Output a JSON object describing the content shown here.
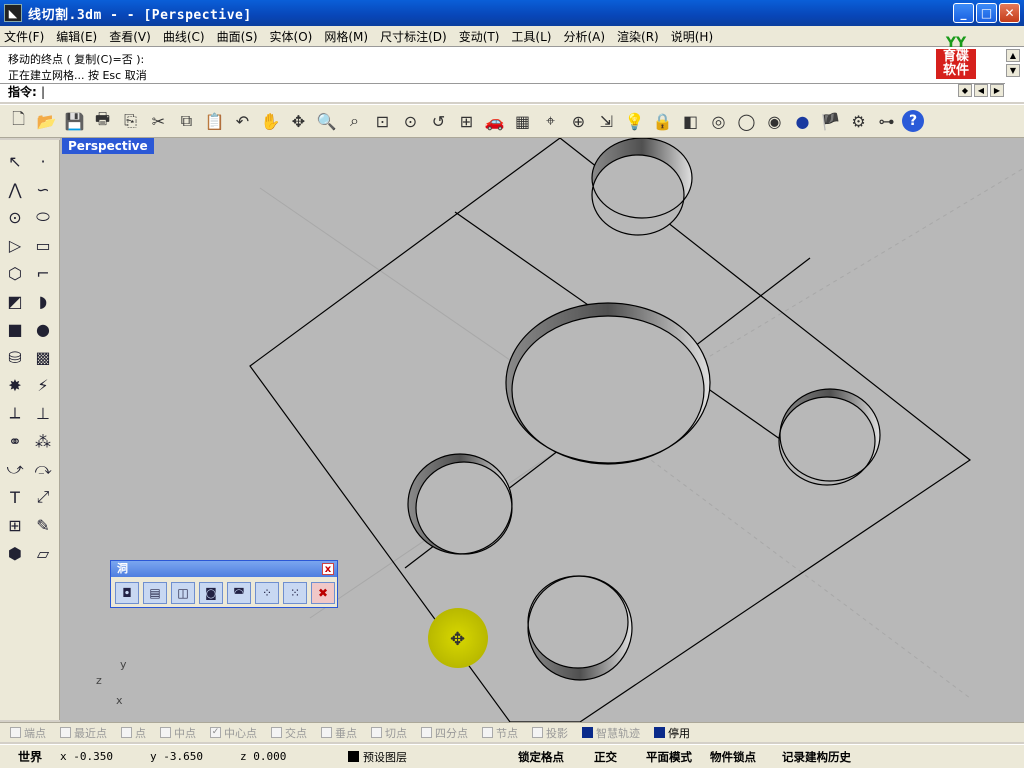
{
  "window": {
    "title": "线切割.3dm - - [Perspective]",
    "minimize": "_",
    "maximize": "□",
    "close": "✕"
  },
  "menu": [
    "文件(F)",
    "编辑(E)",
    "查看(V)",
    "曲线(C)",
    "曲面(S)",
    "实体(O)",
    "网格(M)",
    "尺寸标注(D)",
    "变动(T)",
    "工具(L)",
    "分析(A)",
    "渲染(R)",
    "说明(H)"
  ],
  "command": {
    "history": [
      "移动的终点 ( 复制(C)=否 ):",
      "正在建立网格... 按 Esc 取消"
    ],
    "prompt": "指令:",
    "logo_top": "YY",
    "logo_line1": "育碟",
    "logo_line2": "软件"
  },
  "toolbar_icons": [
    "new-file-icon",
    "open-folder-icon",
    "save-icon",
    "print-icon",
    "import-icon",
    "cut-icon",
    "copy-icon",
    "paste-icon",
    "undo-icon",
    "pan-hand-icon",
    "rotate-view-icon",
    "zoom-icon",
    "zoom-window-icon",
    "zoom-extents-icon",
    "zoom-selected-icon",
    "undo-view-icon",
    "four-views-icon",
    "car-icon",
    "grid-plane-icon",
    "cplane-icon",
    "osnap-icon",
    "move-icon",
    "light-icon",
    "lock-icon",
    "layer-icon",
    "color-wheel-icon",
    "wireframe-sphere-icon",
    "shaded-sphere-icon",
    "render-sphere-icon",
    "render-icon",
    "options-icon",
    "properties-icon",
    "help-icon"
  ],
  "viewport": {
    "label": "Perspective",
    "axis_y": "y",
    "axis_z": "z",
    "axis_x": "x"
  },
  "float_panel": {
    "title": "洞",
    "close": "x"
  },
  "osnap": [
    {
      "label": "端点",
      "checked": false
    },
    {
      "label": "最近点",
      "checked": false
    },
    {
      "label": "点",
      "checked": false
    },
    {
      "label": "中点",
      "checked": false
    },
    {
      "label": "中心点",
      "checked": true
    },
    {
      "label": "交点",
      "checked": false
    },
    {
      "label": "垂点",
      "checked": false
    },
    {
      "label": "切点",
      "checked": false
    },
    {
      "label": "四分点",
      "checked": false
    },
    {
      "label": "节点",
      "checked": false
    },
    {
      "label": "投影",
      "checked": false
    },
    {
      "label": "智慧轨迹",
      "checked": true
    },
    {
      "label": "停用",
      "checked": true
    }
  ],
  "status": {
    "world": "世界",
    "x": "x -0.350",
    "y": "y -3.650",
    "z": "z 0.000",
    "layer": "预设图层",
    "toggles": [
      "锁定格点",
      "正交",
      "平面模式",
      "物件锁点",
      "记录建构历史"
    ]
  }
}
